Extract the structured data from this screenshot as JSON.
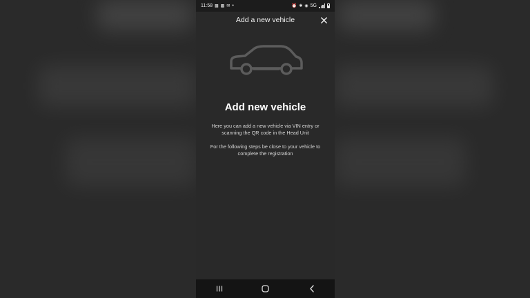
{
  "status_bar": {
    "time": "11:58",
    "dot": "•",
    "network": "5G"
  },
  "header": {
    "title": "Add a new vehicle"
  },
  "main": {
    "heading": "Add new vehicle",
    "paragraph_1": "Here you can add a new vehicle via VIN entry or scanning the QR code in the Head Unit",
    "paragraph_2": "For the following steps be close to your vehicle to complete the registration"
  },
  "icons": {
    "close": "close-icon",
    "car": "car-icon",
    "nav_recents": "recents-icon",
    "nav_home": "home-icon",
    "nav_back": "back-icon"
  },
  "colors": {
    "background": "#292929",
    "status_bar": "#1c1c1c",
    "nav_bar": "#141414",
    "text_primary": "#ffffff",
    "text_secondary": "#d6d6d6",
    "car_outline": "#5c5c5c"
  }
}
